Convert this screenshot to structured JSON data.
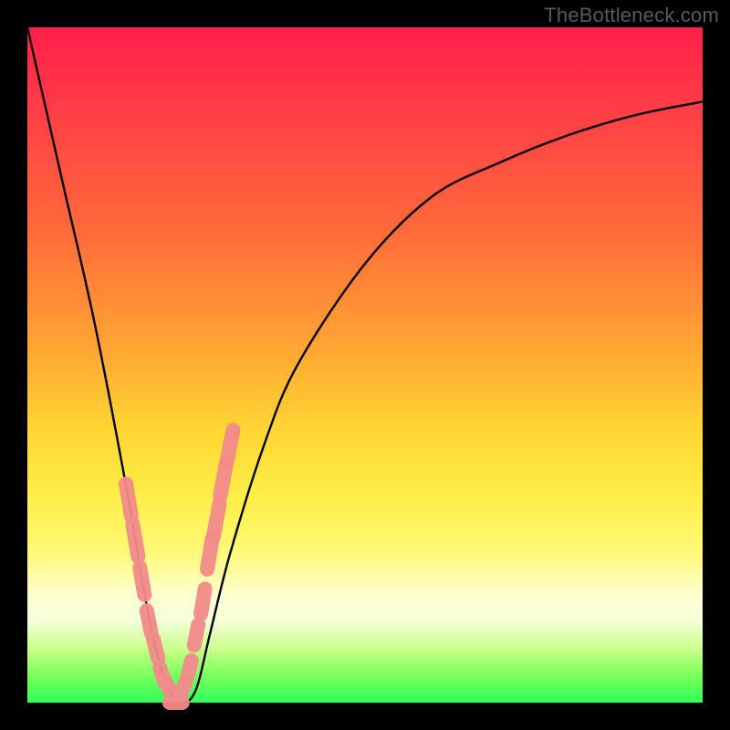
{
  "watermark": "TheBottleneck.com",
  "chart_data": {
    "type": "line",
    "title": "",
    "xlabel": "",
    "ylabel": "",
    "xlim": [
      0,
      100
    ],
    "ylim": [
      0,
      100
    ],
    "grid": false,
    "series": [
      {
        "name": "bottleneck-curve",
        "x": [
          0,
          5,
          10,
          15,
          17,
          19,
          21,
          23,
          25,
          27,
          30,
          35,
          40,
          50,
          60,
          70,
          80,
          90,
          100
        ],
        "values": [
          100,
          78,
          56,
          30,
          18,
          8,
          2,
          0,
          2,
          10,
          22,
          38,
          50,
          65,
          75,
          80,
          84,
          87,
          89
        ]
      }
    ],
    "annotations": [
      {
        "name": "marker-cluster",
        "shape": "rounded-segments",
        "color": "#f38b8b",
        "points_x": [
          15,
          16,
          17,
          18,
          19,
          20,
          21,
          22,
          23,
          24,
          25,
          26,
          27,
          28,
          29,
          30
        ],
        "points_y": [
          30,
          24,
          18,
          12,
          8,
          4,
          2,
          0,
          2,
          5,
          10,
          15,
          22,
          27,
          33,
          38
        ]
      }
    ]
  },
  "colors": {
    "curve": "#000000",
    "markers": "#f38b8b",
    "frame": "#000000"
  }
}
